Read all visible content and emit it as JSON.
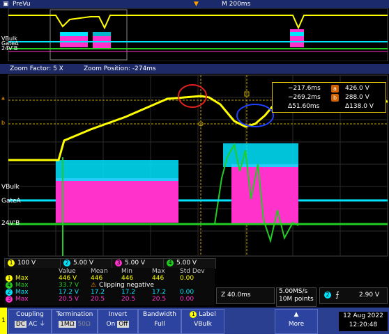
{
  "colors": {
    "ch1": "#ffff00",
    "ch2": "#00e5ff",
    "ch3": "#ff33cc",
    "ch4": "#22cc22",
    "ui_blue": "#2c43a0"
  },
  "overview": {
    "app_title": "PreVu",
    "timebase": "M 200ms",
    "ch_labels": [
      "VBulk",
      "GateA",
      "24V'B"
    ]
  },
  "zoombar": {
    "zoom_factor": "Zoom Factor: 5 X",
    "zoom_position": "Zoom Position: -274ms"
  },
  "cursor_readout": {
    "a_time": "−217.6ms",
    "a_val": "426.0 V",
    "b_time": "−269.2ms",
    "b_val": "288.0 V",
    "delta_time": "Δ51.60ms",
    "delta_val": "Δ138.0 V",
    "a_label": "a",
    "b_label": "b"
  },
  "main": {
    "ch_labels": [
      "VBulk",
      "GateA",
      "24V'B"
    ],
    "marker_a": "a",
    "marker_b": "b"
  },
  "channels": [
    {
      "num": "1",
      "scale": "100 V",
      "color": "#ffff00"
    },
    {
      "num": "2",
      "scale": "5.00 V",
      "color": "#00e5ff"
    },
    {
      "num": "3",
      "scale": "5.00 V",
      "color": "#ff33cc"
    },
    {
      "num": "4",
      "scale": "5.00 V",
      "color": "#22cc22"
    }
  ],
  "measurements": {
    "headers": [
      "Value",
      "Mean",
      "Min",
      "Max",
      "Std Dev"
    ],
    "rows": [
      {
        "num": "1",
        "label": "Max",
        "value": "446 V",
        "mean": "446",
        "min": "446",
        "max": "446",
        "std": "0.00",
        "color": "#ffff00"
      },
      {
        "num": "4",
        "label": "Max",
        "value": "33.7 V",
        "note": "Clipping negative",
        "color": "#22cc22"
      },
      {
        "num": "2",
        "label": "Max",
        "value": "17.2 V",
        "mean": "17.2",
        "min": "17.2",
        "max": "17.2",
        "std": "0.00",
        "color": "#00e5ff"
      },
      {
        "num": "3",
        "label": "Max",
        "value": "20.5 V",
        "mean": "20.5",
        "min": "20.5",
        "max": "20.5",
        "std": "0.00",
        "color": "#ff33cc"
      }
    ]
  },
  "timing": {
    "zoom_time": "Z 40.0ms",
    "sample_rate": "5.00MS/s",
    "record": "10M points",
    "trig_ch": "2",
    "trig_level": "2.90 V"
  },
  "menus": {
    "channel_num": "1",
    "coupling": {
      "title": "Coupling",
      "options": [
        "DC",
        "AC",
        "⏚"
      ]
    },
    "termination": {
      "title": "Termination",
      "options": [
        "1MΩ",
        "50Ω"
      ]
    },
    "invert": {
      "title": "Invert",
      "options": [
        "On",
        "Off"
      ]
    },
    "bandwidth": {
      "title": "Bandwidth",
      "value": "Full"
    },
    "label": {
      "title": "Label",
      "value": "VBulk"
    },
    "more": "More",
    "date": "12 Aug 2022",
    "time": "12:20:48"
  }
}
